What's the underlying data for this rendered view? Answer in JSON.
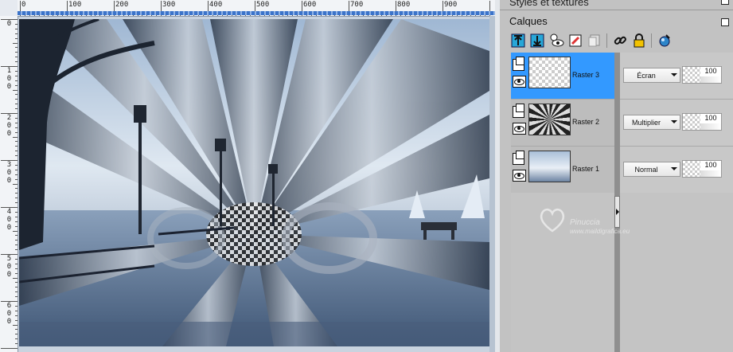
{
  "rulers": {
    "horizontal_labels": [
      "0",
      "100",
      "200",
      "300",
      "400",
      "500",
      "600",
      "700",
      "800",
      "900"
    ],
    "vertical_labels": [
      [
        "0"
      ],
      [
        "1",
        "0",
        "0"
      ],
      [
        "2",
        "0",
        "0"
      ],
      [
        "3",
        "0",
        "0"
      ],
      [
        "4",
        "0",
        "0"
      ],
      [
        "5",
        "0",
        "0"
      ],
      [
        "6",
        "0",
        "0"
      ]
    ]
  },
  "panel": {
    "styles_title": "Styles et textures",
    "calques_title": "Calques"
  },
  "toolbar_icons": [
    "move-layer-up-icon",
    "move-layer-down-icon",
    "visibility-toggle-icon",
    "edit-layer-icon",
    "duplicate-layer-icon",
    "link-icon",
    "lock-icon",
    "layer-properties-icon"
  ],
  "layers": [
    {
      "name": "Raster 3",
      "blend_mode": "Écran",
      "opacity": "100",
      "selected": true
    },
    {
      "name": "Raster 2",
      "blend_mode": "Multiplier",
      "opacity": "100",
      "selected": false
    },
    {
      "name": "Raster 1",
      "blend_mode": "Normal",
      "opacity": "100",
      "selected": false
    }
  ],
  "watermark": {
    "name": "Pinuccia",
    "url": "www.maildigrafica.eu"
  },
  "colors": {
    "selected_layer": "#3399ff",
    "panel_bg": "#c2c2c2",
    "ruler_accent": "#3b73c9"
  }
}
